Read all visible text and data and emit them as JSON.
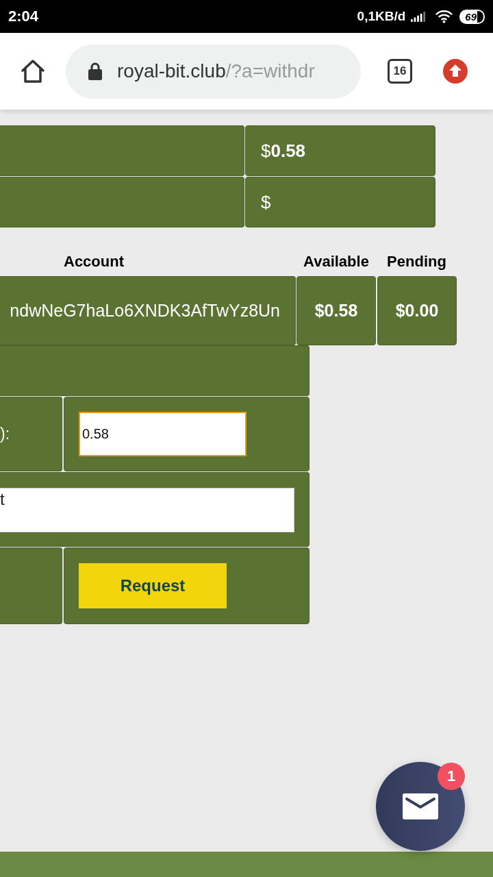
{
  "status_bar": {
    "time": "2:04",
    "network_speed": "0,1KB/d",
    "battery": "69"
  },
  "browser": {
    "url_host": "royal-bit.club",
    "url_path": "/?a=withdr",
    "tab_count": "16"
  },
  "summary_table": {
    "rows": [
      {
        "value": "$**0.58**"
      },
      {
        "value": "$"
      }
    ]
  },
  "accounts_table": {
    "columns": [
      "Account",
      "Available",
      "Pending"
    ],
    "rows": [
      {
        "account": "ndwNeG7haLo6XNDK3AfTwYz8Un",
        "available": "$0.58",
        "pending": "$0.00"
      }
    ]
  },
  "form": {
    "rows": [
      {
        "kind": "blank"
      },
      {
        "kind": "input",
        "label": "):",
        "value": "0.58"
      },
      {
        "kind": "textarea",
        "value": "t"
      },
      {
        "kind": "button",
        "label": "Request"
      }
    ]
  },
  "chat": {
    "badge": "1"
  }
}
